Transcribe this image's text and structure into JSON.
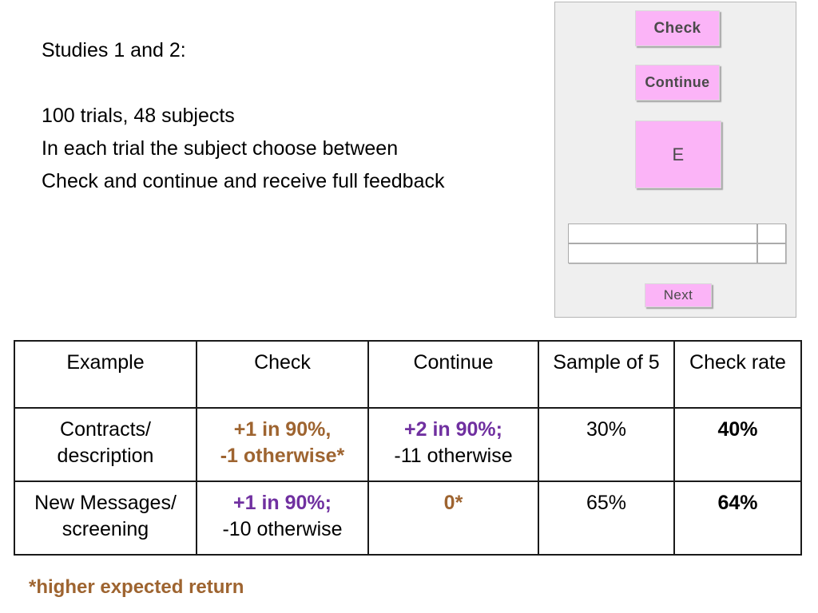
{
  "intro": {
    "lines": [
      "Studies 1 and 2:",
      "",
      "100 trials, 48 subjects",
      "In each trial the subject choose between",
      "Check and continue and receive full feedback"
    ]
  },
  "experiment_panel": {
    "check_button": "Check",
    "continue_button": "Continue",
    "stimulus_box": "E",
    "next_button": "Next",
    "feedback_rows": [
      "",
      ""
    ],
    "feedback_scores": [
      "",
      ""
    ],
    "colors": {
      "panel_background": "#efefef",
      "button_pink": "#fbb4f7",
      "panel_border": "#b5b5b5"
    }
  },
  "results_table": {
    "headers": [
      "Example",
      "Check",
      "Continue",
      "Sample of 5",
      "Check rate"
    ],
    "rows": [
      {
        "example_line1": "Contracts/",
        "example_line2": "description",
        "check_line1": "+1 in 90%,",
        "check_line2": "-1 otherwise*",
        "check_line1_color": "brown",
        "check_line2_color": "brown",
        "continue_line1": "+2 in 90%;",
        "continue_line2": "-11 otherwise",
        "continue_line1_color": "purple",
        "continue_line2_color": "black",
        "sample_of_5": "30%",
        "check_rate": "40%"
      },
      {
        "example_line1": "New Messages/",
        "example_line2": "screening",
        "check_line1": "+1 in 90%;",
        "check_line2": "-10 otherwise",
        "check_line1_color": "purple",
        "check_line2_color": "black",
        "continue_line1": "0*",
        "continue_line2": "",
        "continue_line1_color": "brown",
        "continue_line2_color": "black",
        "sample_of_5": "65%",
        "check_rate": "64%"
      }
    ]
  },
  "footnote": "*higher expected return",
  "colors": {
    "brown": "#9e6430",
    "purple": "#7030a0",
    "black": "#000000"
  }
}
